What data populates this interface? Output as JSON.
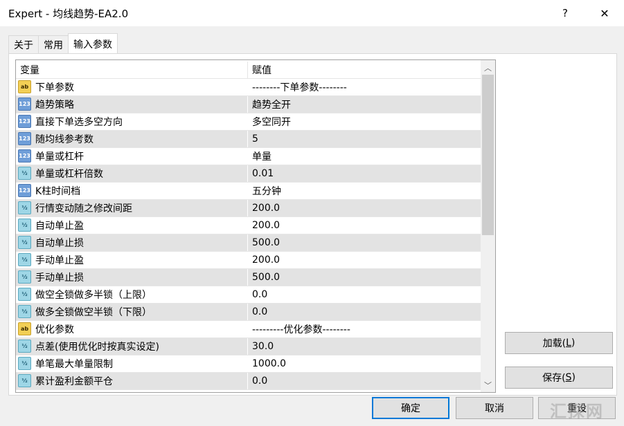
{
  "window": {
    "title": "Expert - 均线趋势-EA2.0",
    "help_label": "?",
    "close_label": "✕"
  },
  "tabs": [
    {
      "label": "关于"
    },
    {
      "label": "常用"
    },
    {
      "label": "输入参数",
      "active": true
    }
  ],
  "grid": {
    "columns": {
      "variable": "变量",
      "value": "赋值"
    },
    "rows": [
      {
        "icon": "string-icon",
        "name": "下单参数",
        "value": "--------下单参数--------"
      },
      {
        "icon": "integer-icon",
        "name": "趋势策略",
        "value": "趋势全开"
      },
      {
        "icon": "integer-icon",
        "name": "直接下单选多空方向",
        "value": "多空同开"
      },
      {
        "icon": "integer-icon",
        "name": "随均线参考数",
        "value": "5"
      },
      {
        "icon": "integer-icon",
        "name": "单量或杠杆",
        "value": "单量"
      },
      {
        "icon": "double-icon",
        "name": "单量或杠杆倍数",
        "value": "0.01"
      },
      {
        "icon": "integer-icon",
        "name": "K柱时间档",
        "value": "五分钟"
      },
      {
        "icon": "double-icon",
        "name": "行情变动随之修改间距",
        "value": "200.0"
      },
      {
        "icon": "double-icon",
        "name": "自动单止盈",
        "value": "200.0"
      },
      {
        "icon": "double-icon",
        "name": "自动单止损",
        "value": "500.0"
      },
      {
        "icon": "double-icon",
        "name": "手动单止盈",
        "value": "200.0"
      },
      {
        "icon": "double-icon",
        "name": "手动单止损",
        "value": "500.0"
      },
      {
        "icon": "double-icon",
        "name": "做空全锁做多半锁（上限）",
        "value": "0.0"
      },
      {
        "icon": "double-icon",
        "name": "做多全锁做空半锁（下限）",
        "value": "0.0"
      },
      {
        "icon": "string-icon",
        "name": "优化参数",
        "value": "---------优化参数--------"
      },
      {
        "icon": "double-icon",
        "name": "点差(使用优化时按真实设定)",
        "value": "30.0"
      },
      {
        "icon": "double-icon",
        "name": "单笔最大单量限制",
        "value": "1000.0"
      },
      {
        "icon": "double-icon",
        "name": "累计盈利金额平仓",
        "value": "0.0"
      }
    ]
  },
  "icon_glyphs": {
    "string-icon": "ab",
    "integer-icon": "123",
    "double-icon": "½"
  },
  "buttons": {
    "load": {
      "text": "加载(",
      "key": "L",
      "tail": ")"
    },
    "save": {
      "text": "保存(",
      "key": "S",
      "tail": ")"
    },
    "ok": "确定",
    "cancel": "取消",
    "reset": "重设"
  },
  "watermark": "汇探网"
}
